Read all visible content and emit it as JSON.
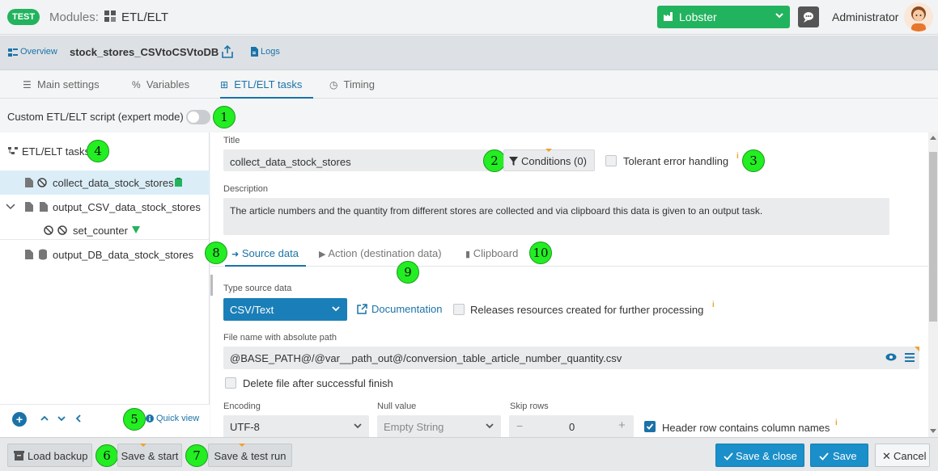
{
  "topbar": {
    "env_badge": "TEST",
    "modules_label": "Modules:",
    "module_name": "ETL/ELT",
    "instance_select": "Lobster",
    "user_name": "Administrator"
  },
  "breadcrumb": {
    "overview": "Overview",
    "title": "stock_stores_CSVtoCSVtoDB",
    "logs": "Logs"
  },
  "tabs": [
    "Main settings",
    "Variables",
    "ETL/ELT tasks",
    "Timing"
  ],
  "custom_script_label": "Custom ETL/ELT script (expert mode)",
  "badges": [
    "1",
    "2",
    "3",
    "4",
    "5",
    "6",
    "7",
    "8",
    "9",
    "10"
  ],
  "tree": {
    "header": "ETL/ELT tasks",
    "items": [
      {
        "label": "collect_data_stock_stores"
      },
      {
        "label": "output_CSV_data_stock_stores"
      },
      {
        "label": "set_counter"
      },
      {
        "label": "output_DB_data_stock_stores"
      }
    ],
    "quick_view": "Quick view"
  },
  "task": {
    "title_label": "Title",
    "title_value": "collect_data_stock_stores",
    "conditions_button": "Conditions (0)",
    "tolerant_label": "Tolerant error handling",
    "description_label": "Description",
    "description_value": "The article numbers and the quantity from different stores are collected and via clipboard this data is given to an output task."
  },
  "subtabs": [
    "Source data",
    "Action (destination data)",
    "Clipboard"
  ],
  "source": {
    "type_label": "Type source data",
    "type_value": "CSV/Text",
    "documentation_link": "Documentation",
    "releases_label": "Releases resources created for further processing",
    "filename_label": "File name with absolute path",
    "filename_value": "@BASE_PATH@/@var__path_out@/conversion_table_article_number_quantity.csv",
    "delete_label": "Delete file after successful finish",
    "encoding_label": "Encoding",
    "encoding_value": "UTF-8",
    "null_label": "Null value",
    "null_value": "Empty String",
    "skip_label": "Skip rows",
    "skip_value": "0",
    "header_row_label": "Header row contains column names"
  },
  "actions": {
    "load_backup": "Load backup",
    "save_start": "Save & start",
    "save_test": "Save & test run",
    "save_close": "Save & close",
    "save": "Save",
    "cancel": "Cancel"
  },
  "colors": {
    "accent": "#1a73a8",
    "green": "#22b35e",
    "badge_green": "#22ee22",
    "marker_orange": "#f0a030"
  }
}
